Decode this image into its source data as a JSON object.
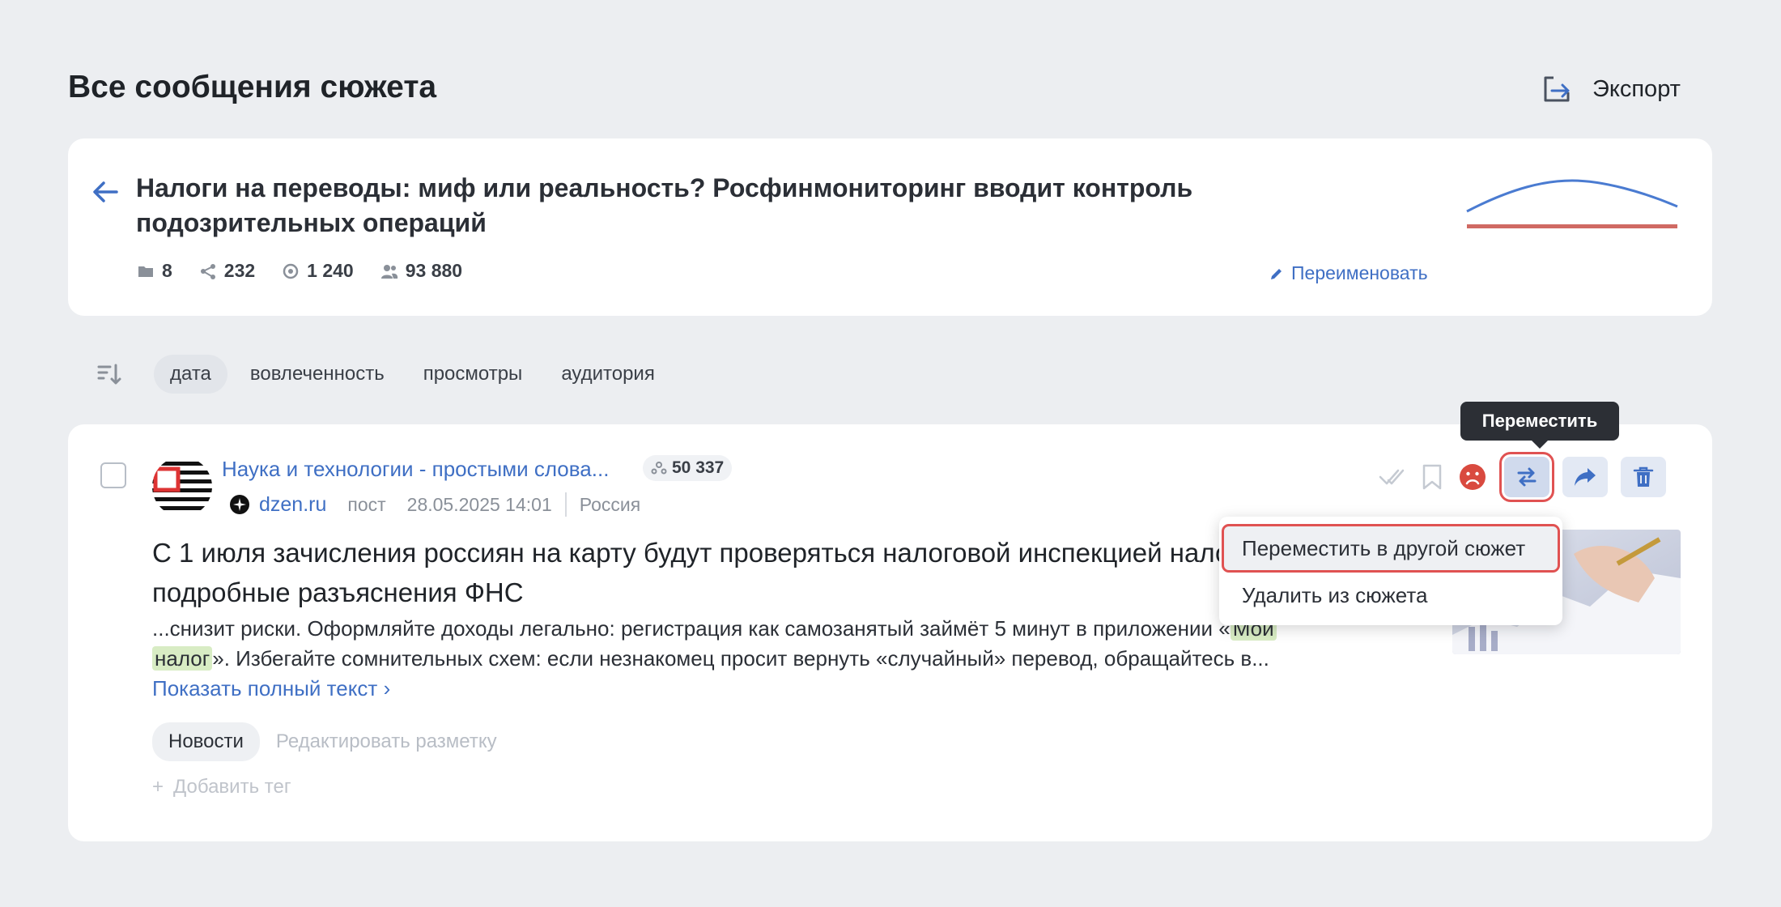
{
  "header": {
    "title": "Все сообщения сюжета",
    "export_label": "Экспорт"
  },
  "story": {
    "title": "Налоги на переводы: миф или реальность? Росфинмониторинг вводит контроль подозрительных операций",
    "stats": {
      "posts": "8",
      "reposts": "232",
      "views": "1 240",
      "audience": "93 880"
    },
    "rename_label": "Переименовать",
    "sparkline_color": "#4a7bd1",
    "sentiment_bar_color": "#d06a63"
  },
  "sort": {
    "options": [
      "дата",
      "вовлеченность",
      "просмотры",
      "аудитория"
    ],
    "active": "дата"
  },
  "post": {
    "source_name": "Наука и технологии - простыми слова...",
    "audience": "50 337",
    "domain": "dzen.ru",
    "type": "пост",
    "date": "28.05.2025 14:01",
    "region": "Россия",
    "title": "С 1 июля зачисления россиян на карту будут проверяться налоговой инспекцией налогом: подробные разъяснения ФНС",
    "excerpt_part1": "...снизит риски. Оформляйте доходы легально: регистрация как самозанятый займёт 5 минут в приложении «",
    "hl1": "Мой",
    "hl2": "налог",
    "excerpt_part2": "». Избегайте сомнительных схем: если незнакомец просит вернуть «случайный» перевод, обращайтесь в...",
    "show_full_label": "Показать полный текст",
    "tag": "Новости",
    "edit_markup_label": "Редактировать разметку",
    "add_tag_label": "Добавить тег"
  },
  "tooltip": {
    "label": "Переместить"
  },
  "dropdown": {
    "items": [
      "Переместить в другой сюжет",
      "Удалить из сюжета"
    ]
  }
}
